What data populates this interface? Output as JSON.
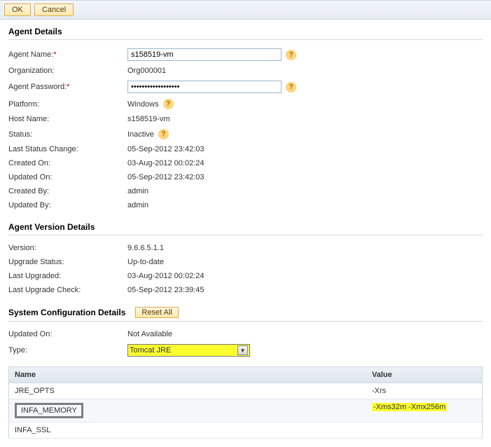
{
  "toolbar": {
    "ok": "OK",
    "cancel": "Cancel"
  },
  "agent_details": {
    "title": "Agent Details",
    "agent_name_label": "Agent Name:",
    "agent_name_value": "s158519-vm",
    "organization_label": "Organization:",
    "organization_value": "Org000001",
    "agent_password_label": "Agent Password:",
    "agent_password_value": "••••••••••••••••••",
    "platform_label": "Platform:",
    "platform_value": "Windows",
    "host_name_label": "Host Name:",
    "host_name_value": "s158519-vm",
    "status_label": "Status:",
    "status_value": "Inactive",
    "last_status_change_label": "Last Status Change:",
    "last_status_change_value": "05-Sep-2012 23:42:03",
    "created_on_label": "Created On:",
    "created_on_value": "03-Aug-2012 00:02:24",
    "updated_on_label": "Updated On:",
    "updated_on_value": "05-Sep-2012 23:42:03",
    "created_by_label": "Created By:",
    "created_by_value": "admin",
    "updated_by_label": "Updated By:",
    "updated_by_value": "admin"
  },
  "version_details": {
    "title": "Agent Version Details",
    "version_label": "Version:",
    "version_value": "9.6.6.5.1.1",
    "upgrade_status_label": "Upgrade Status:",
    "upgrade_status_value": "Up-to-date",
    "last_upgraded_label": "Last Upgraded:",
    "last_upgraded_value": "03-Aug-2012 00:02:24",
    "last_upgrade_check_label": "Last Upgrade Check:",
    "last_upgrade_check_value": "05-Sep-2012 23:39:45"
  },
  "sys_config": {
    "title": "System Configuration Details",
    "reset_all": "Reset All",
    "updated_on_label": "Updated On:",
    "updated_on_value": "Not Available",
    "type_label": "Type:",
    "type_value": "Tomcat JRE",
    "col_name": "Name",
    "col_value": "Value",
    "rows": [
      {
        "name": "JRE_OPTS",
        "value": "-Xrs"
      },
      {
        "name": "INFA_MEMORY",
        "value": "-Xms32m -Xmx256m"
      },
      {
        "name": "INFA_SSL",
        "value": ""
      }
    ]
  },
  "help": "?"
}
